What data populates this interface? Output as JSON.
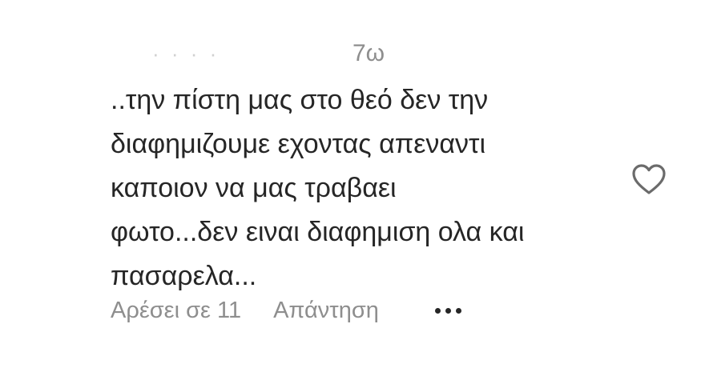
{
  "comment": {
    "username": "· · · ·",
    "timestamp": "7ω",
    "lines": [
      "..την πίστη μας στο θεό δεν την",
      "διαφημιζουμε εχοντας απεναντι",
      "καποιον να μας τραβαει",
      "φωτο...δεν ειναι διαφημιση ολα και",
      "πασαρελα..."
    ],
    "likes_label": "Αρέσει σε 11",
    "reply_label": "Απάντηση",
    "like_icon": "heart-outline-icon",
    "more_icon": "more-options-icon"
  }
}
